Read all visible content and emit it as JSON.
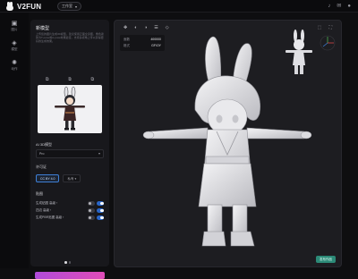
{
  "app": {
    "logo_text": "V2FUN",
    "workspace_label": "工作室",
    "workspace_chevron": "▾"
  },
  "top_icons": [
    "bell-icon",
    "gift-icon",
    "user-icon"
  ],
  "nav": [
    {
      "icon": "▣",
      "label": "图片",
      "name": "image"
    },
    {
      "icon": "◈",
      "label": "模型",
      "name": "model"
    },
    {
      "icon": "✺",
      "label": "动作",
      "name": "motion"
    }
  ],
  "panel": {
    "title": "新模型",
    "description": "上传您的图片生成3D模型，建议使用正面全身图，角色姿势为T-pose或A-pose效果最佳，支持多视角上传以获得更好的生成效果。",
    "thumb_tabs": [
      "⧉",
      "⧉",
      "⧉"
    ],
    "model_section": "AI 3D模型",
    "model_value": "Pro",
    "license_section": "许可证",
    "license_options": [
      "CC BY 4.0",
      "私有 ▾"
    ],
    "advanced_section": "贴图",
    "toggles": [
      {
        "label": "生成贴图 高级 ›",
        "state": "on"
      },
      {
        "label": "四边 高级 ›",
        "state": "on"
      },
      {
        "label": "生成PBR贴图 高级 ›",
        "state": "on"
      }
    ]
  },
  "viewport": {
    "tool_icons": [
      "✥",
      "◐",
      "◑",
      "☰",
      "◇"
    ],
    "right_icons": [
      "⬚",
      "⛶"
    ],
    "stats": [
      {
        "label": "面数",
        "value": "400000"
      },
      {
        "label": "格式",
        "value": "GF/OY"
      }
    ],
    "action_label": "发布作品"
  },
  "colors": {
    "accent_blue": "#2a66c8",
    "generate_gradient_start": "#b04bd9",
    "generate_gradient_end": "#e14cb8",
    "action_teal": "#2c8a77"
  }
}
